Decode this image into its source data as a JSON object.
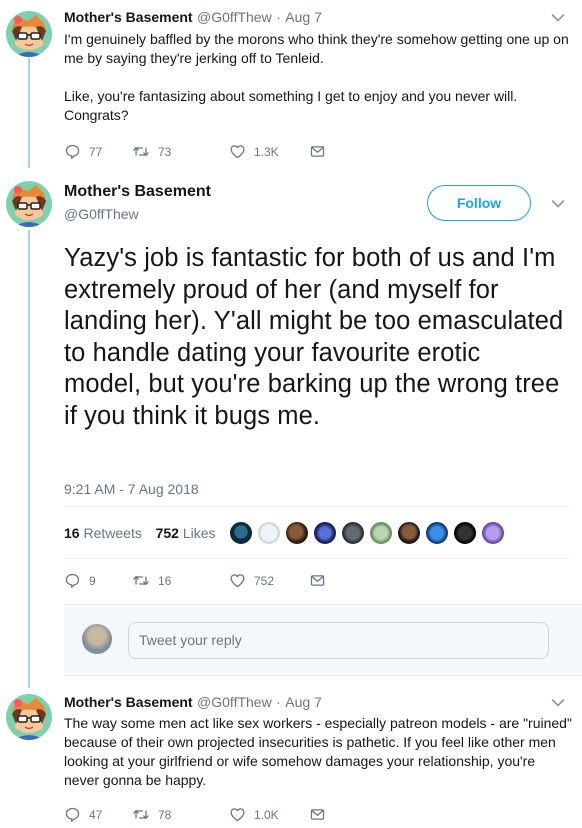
{
  "tweet1": {
    "display_name": "Mother's Basement",
    "handle": "@G0ffThew",
    "separator": "·",
    "date": "Aug 7",
    "text_p1": "I'm genuinely baffled by the morons who think they're somehow getting one up on me by saying they're jerking off to Tenleid.",
    "text_p2": "Like, you're fantasizing about something I get to enjoy and you never will. Congrats?",
    "replies": "77",
    "retweets": "73",
    "likes": "1.3K"
  },
  "main": {
    "display_name": "Mother's Basement",
    "handle": "@G0ffThew",
    "follow_label": "Follow",
    "text": "Yazy's job is fantastic for both of us and I'm extremely proud of her (and myself for landing her). Y'all might be too emasculated to handle dating your favourite erotic model, but you're barking up the wrong tree if you think it bugs me.",
    "timestamp": "9:21 AM - 7 Aug 2018",
    "retweet_count": "16",
    "retweet_label": "Retweets",
    "like_count": "752",
    "like_label": "Likes",
    "replies": "9",
    "retweets": "16",
    "likes": "752",
    "reply_placeholder": "Tweet your reply"
  },
  "tweet3": {
    "display_name": "Mother's Basement",
    "handle": "@G0ffThew",
    "separator": "·",
    "date": "Aug 7",
    "text": "The way some men act like sex workers - especially patreon models - are \"ruined\" because of their own projected insecurities is pathetic. If you feel like other men looking at your girlfriend or wife somehow damages your relationship, you're never gonna be happy.",
    "replies": "47",
    "retweets": "78",
    "likes": "1.0K"
  },
  "icons": {
    "reply": "reply-icon",
    "retweet": "retweet-icon",
    "like": "heart-icon",
    "dm": "envelope-icon",
    "caret": "chevron-down-icon"
  },
  "colors": {
    "accent": "#1da1f2",
    "muted": "#657786",
    "thread_line": "#a3d4f2",
    "text": "#14171a"
  }
}
